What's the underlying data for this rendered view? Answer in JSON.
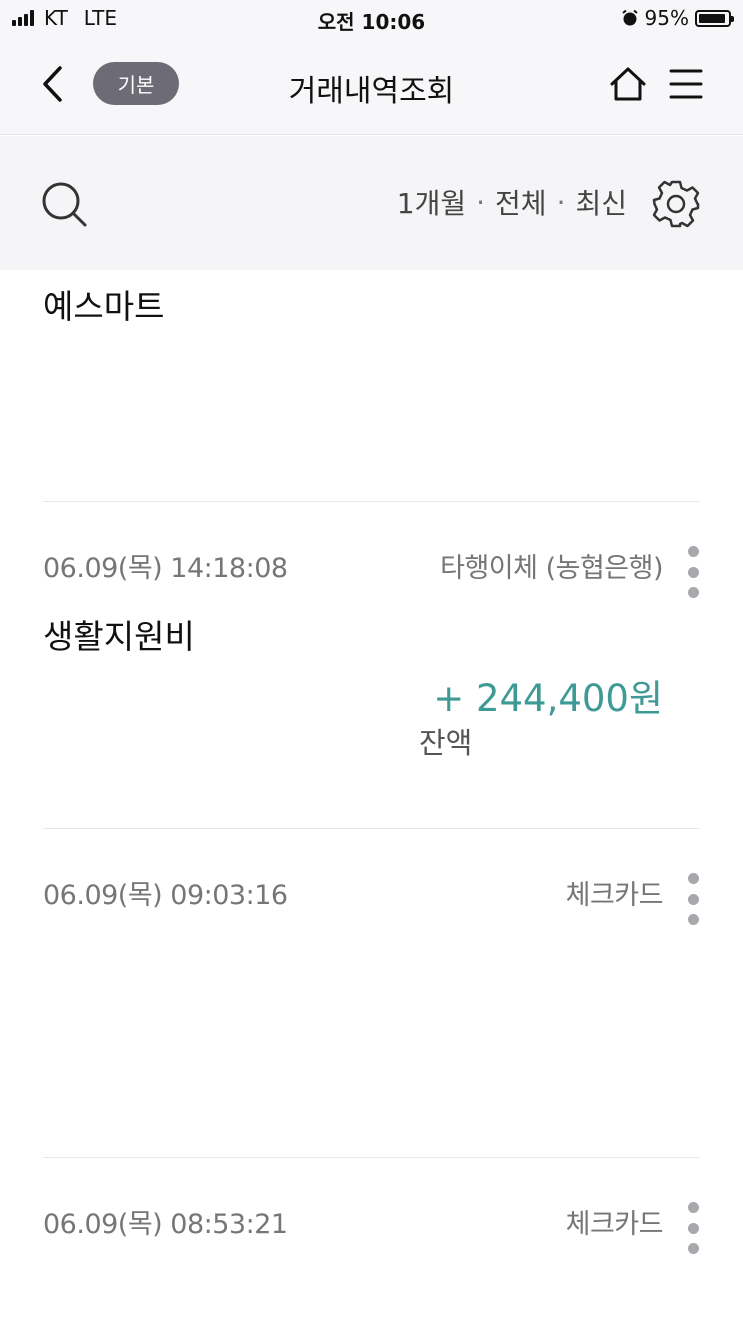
{
  "status_bar": {
    "carrier": "KT",
    "network": "LTE",
    "time": "오전 10:06",
    "battery": "95%",
    "battery_level": 0.95
  },
  "nav": {
    "back_icon": "chevron-left-icon",
    "badge": "기본",
    "title": "거래내역조회",
    "home_icon": "home-icon",
    "menu_icon": "hamburger-menu-icon"
  },
  "filter": {
    "search_icon": "search-icon",
    "period": "1개월",
    "separator": "·",
    "scope": "전체",
    "order": "최신",
    "settings_icon": "gear-icon"
  },
  "transactions": [
    {
      "name": "예스마트"
    },
    {
      "datetime": "06.09(목) 14:18:08",
      "type": "타행이체 (농협은행)",
      "name": "생활지원비",
      "amount": "+ 244,400원",
      "balance_label": "잔액"
    },
    {
      "datetime": "06.09(목) 09:03:16",
      "type": "체크카드"
    },
    {
      "datetime": "06.09(목) 08:53:21",
      "type": "체크카드"
    }
  ],
  "colors": {
    "deposit_amount": "#3e9a95",
    "badge_bg": "#6d6c76",
    "header_bg": "#f7f7f9"
  }
}
